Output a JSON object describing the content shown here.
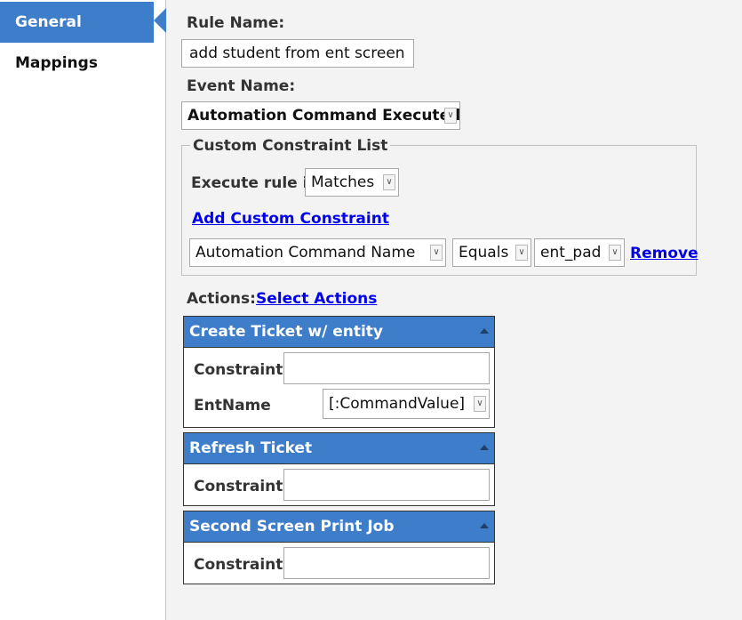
{
  "sidebar": {
    "items": [
      {
        "label": "General Settings",
        "active": true
      },
      {
        "label": "Mappings",
        "active": false
      }
    ]
  },
  "form": {
    "rule_name_label": "Rule Name:",
    "rule_name_value": "add student from ent screen",
    "event_name_label": "Event Name:",
    "event_name_value": "Automation Command Executed"
  },
  "constraints": {
    "legend": "Custom Constraint List",
    "execute_label": "Execute rule if",
    "execute_value": "Matches",
    "add_link": "Add Custom Constraint",
    "row": {
      "field": "Automation Command Name",
      "operator": "Equals",
      "value": "ent_pad",
      "remove": "Remove"
    }
  },
  "actions": {
    "label": "Actions:",
    "select_link": "Select Actions",
    "panels": [
      {
        "title": "Create Ticket w/ entity",
        "constraint_label": "Constraint:",
        "constraint_value": "",
        "entname_label": "EntName",
        "entname_value": "[:CommandValue]"
      },
      {
        "title": "Refresh Ticket",
        "constraint_label": "Constraint:",
        "constraint_value": ""
      },
      {
        "title": "Second Screen Print Job",
        "constraint_label": "Constraint:",
        "constraint_value": ""
      }
    ]
  },
  "colors": {
    "accent": "#3d7dca",
    "link": "#0000ee",
    "background": "#f3f3f3"
  }
}
